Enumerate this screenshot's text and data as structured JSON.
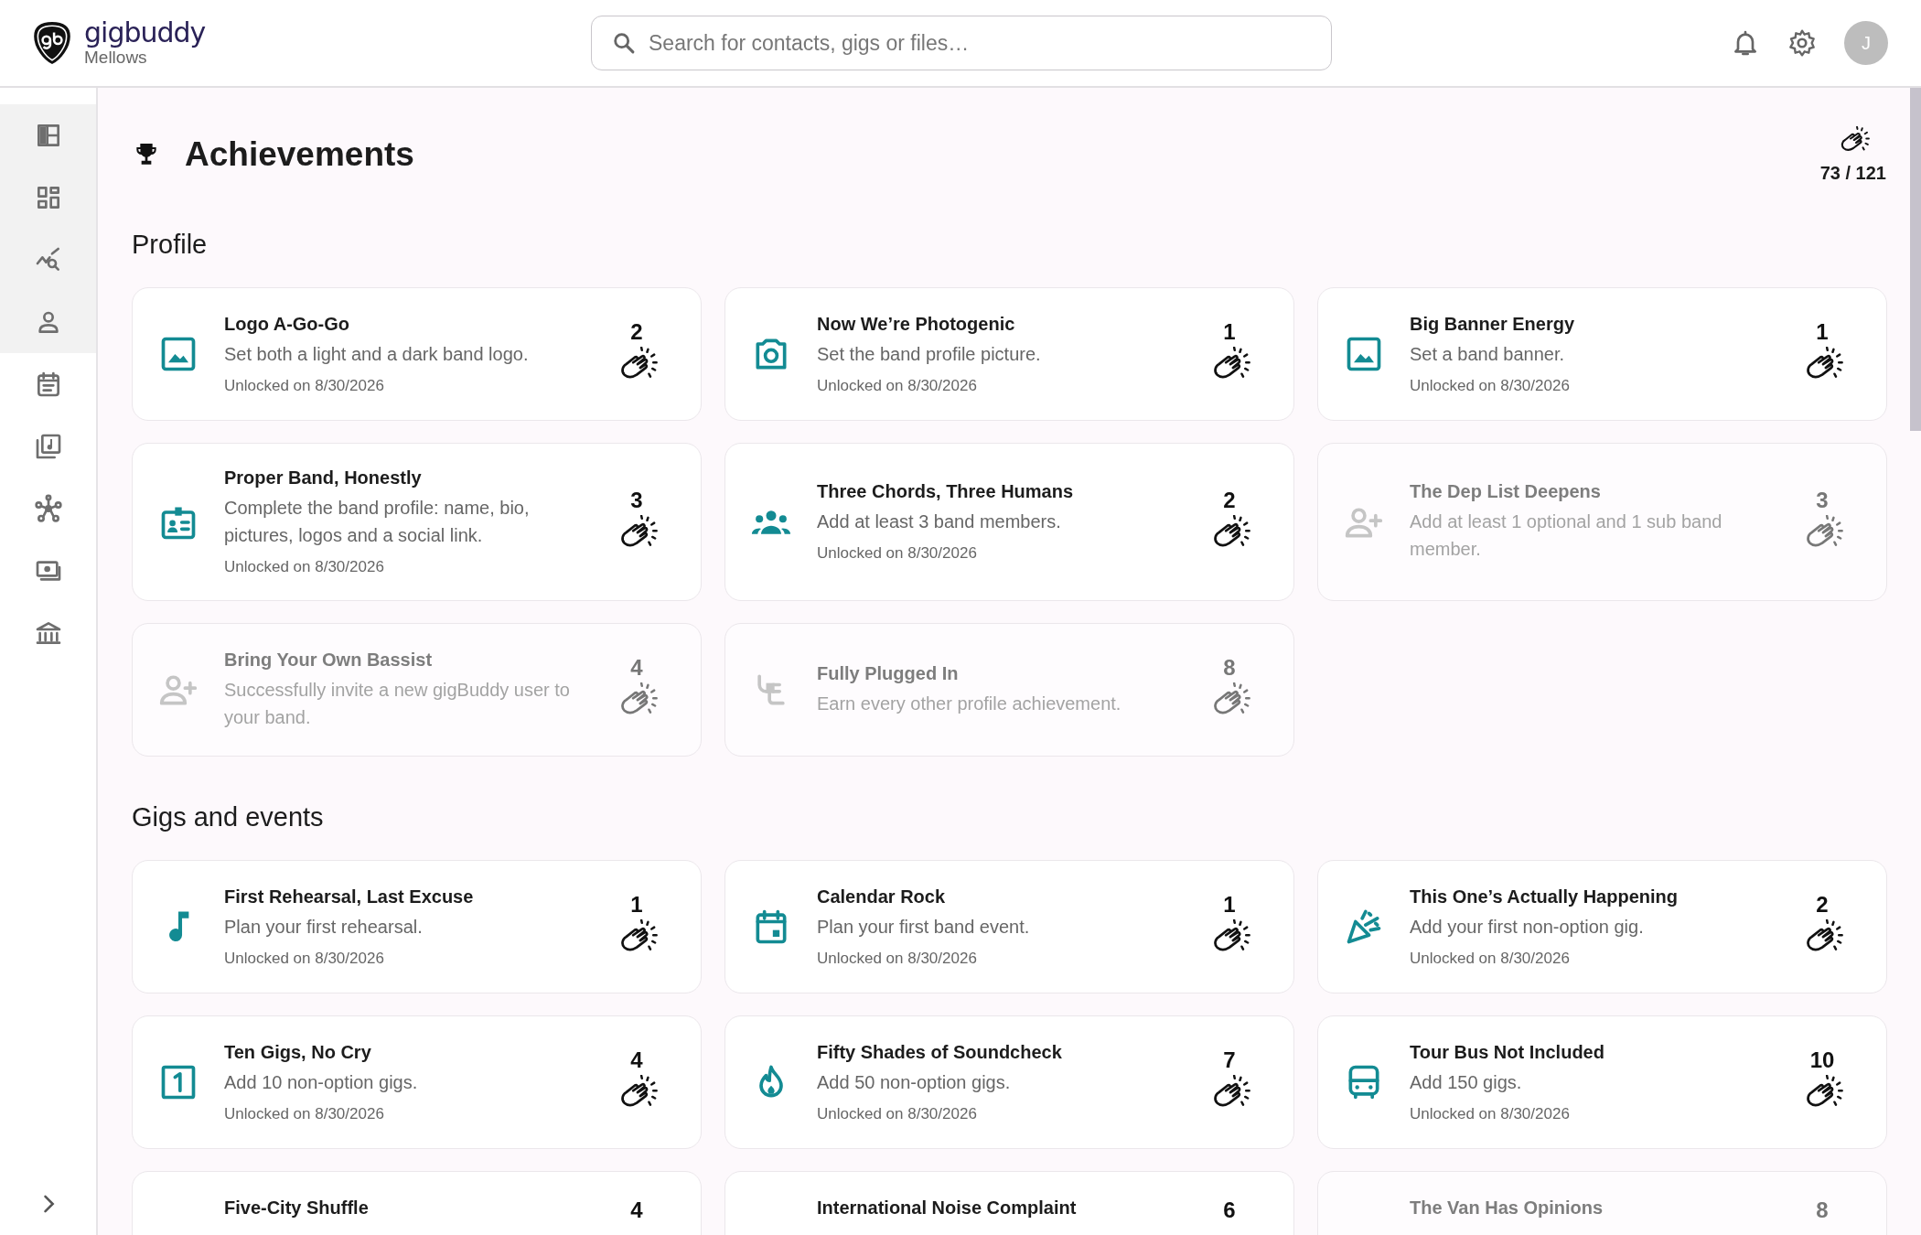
{
  "header": {
    "brand": "gigbuddy",
    "band": "Mellows",
    "search": {
      "placeholder": "Search for contacts, gigs or files…"
    },
    "avatar": "J"
  },
  "sidebar": {
    "items": [
      {
        "highlighted": true
      },
      {
        "highlighted": true
      },
      {
        "highlighted": true
      },
      {
        "highlighted": true
      },
      {
        "highlighted": false
      },
      {
        "highlighted": false
      },
      {
        "highlighted": false
      },
      {
        "highlighted": false
      },
      {
        "highlighted": false
      }
    ]
  },
  "page": {
    "title": "Achievements",
    "score": "73 / 121"
  },
  "sections": [
    {
      "title": "Profile",
      "achievements": [
        {
          "title": "Logo A-Go-Go",
          "description": "Set both a light and a dark band logo.",
          "points": "2",
          "unlocked": true,
          "date": "Unlocked on 8/30/2026"
        },
        {
          "title": "Now We’re Photogenic",
          "description": "Set the band profile picture.",
          "points": "1",
          "unlocked": true,
          "date": "Unlocked on 8/30/2026"
        },
        {
          "title": "Big Banner Energy",
          "description": "Set a band banner.",
          "points": "1",
          "unlocked": true,
          "date": "Unlocked on 8/30/2026"
        },
        {
          "title": "Proper Band, Honestly",
          "description": "Complete the band profile: name, bio, pictures, logos and a social link.",
          "points": "3",
          "unlocked": true,
          "date": "Unlocked on 8/30/2026"
        },
        {
          "title": "Three Chords, Three Humans",
          "description": "Add at least 3 band members.",
          "points": "2",
          "unlocked": true,
          "date": "Unlocked on 8/30/2026"
        },
        {
          "title": "The Dep List Deepens",
          "description": "Add at least 1 optional and 1 sub band member.",
          "points": "3",
          "unlocked": false
        },
        {
          "title": "Bring Your Own Bassist",
          "description": "Successfully invite a new gigBuddy user to your band.",
          "points": "4",
          "unlocked": false
        },
        {
          "title": "Fully Plugged In",
          "description": "Earn every other profile achievement.",
          "points": "8",
          "unlocked": false
        }
      ]
    },
    {
      "title": "Gigs and events",
      "achievements": [
        {
          "title": "First Rehearsal, Last Excuse",
          "description": "Plan your first rehearsal.",
          "points": "1",
          "unlocked": true,
          "date": "Unlocked on 8/30/2026"
        },
        {
          "title": "Calendar Rock",
          "description": "Plan your first band event.",
          "points": "1",
          "unlocked": true,
          "date": "Unlocked on 8/30/2026"
        },
        {
          "title": "This One’s Actually Happening",
          "description": "Add your first non-option gig.",
          "points": "2",
          "unlocked": true,
          "date": "Unlocked on 8/30/2026"
        },
        {
          "title": "Ten Gigs, No Cry",
          "description": "Add 10 non-option gigs.",
          "points": "4",
          "unlocked": true,
          "date": "Unlocked on 8/30/2026"
        },
        {
          "title": "Fifty Shades of Soundcheck",
          "description": "Add 50 non-option gigs.",
          "points": "7",
          "unlocked": true,
          "date": "Unlocked on 8/30/2026"
        },
        {
          "title": "Tour Bus Not Included",
          "description": "Add 150 gigs.",
          "points": "10",
          "unlocked": true,
          "date": "Unlocked on 8/30/2026"
        },
        {
          "title": "Five-City Shuffle",
          "points": "4",
          "unlocked": true
        },
        {
          "title": "International Noise Complaint",
          "points": "6",
          "unlocked": true
        },
        {
          "title": "The Van Has Opinions",
          "points": "8",
          "unlocked": false
        }
      ]
    }
  ]
}
